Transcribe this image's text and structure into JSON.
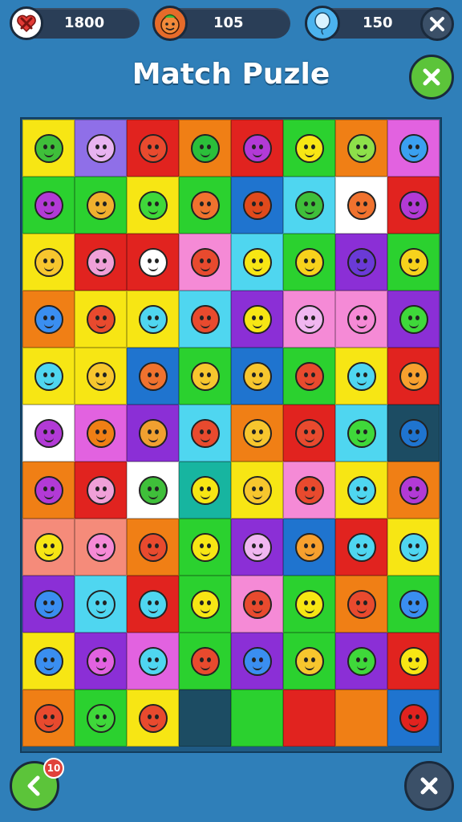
{
  "top_bar": {
    "stat1": {
      "value": "1800",
      "icon": "heart-x-icon",
      "icon_color": "#e23b36"
    },
    "stat2": {
      "value": "105",
      "icon": "character-face-icon",
      "icon_color": "#e66b2a"
    },
    "stat3": {
      "value": "150",
      "icon": "balloon-icon",
      "icon_color": "#4bb3ee"
    },
    "close_icon": "close-icon"
  },
  "title": "Match Puzle",
  "header_close_icon": "close-icon",
  "board": {
    "columns": 8,
    "rows": 11,
    "cells": [
      [
        "#f7e614",
        "#8f6fe8",
        "#e1231f",
        "#f07f15",
        "#e1231f",
        "#2bd12f",
        "#f07f15",
        "#e262e0"
      ],
      [
        "#2bd12f",
        "#2bd12f",
        "#f7e614",
        "#2bd12f",
        "#1f74cf",
        "#4fd6f0",
        "#ffffff",
        "#e1231f"
      ],
      [
        "#f7e614",
        "#e1231f",
        "#e1231f",
        "#f58ad6",
        "#4fd6f0",
        "#2bd12f",
        "#8b2fd6",
        "#2bd12f"
      ],
      [
        "#f07f15",
        "#f7e614",
        "#f7e614",
        "#4fd6f0",
        "#8b2fd6",
        "#f58ad6",
        "#f58ad6",
        "#8b2fd6"
      ],
      [
        "#f7e614",
        "#f7e614",
        "#1f74cf",
        "#2bd12f",
        "#1f74cf",
        "#2bd12f",
        "#f7e614",
        "#e1231f"
      ],
      [
        "#ffffff",
        "#e262e0",
        "#8b2fd6",
        "#4fd6f0",
        "#f07f15",
        "#e1231f",
        "#4fd6f0",
        "#1c4c63"
      ],
      [
        "#f07f15",
        "#e1231f",
        "#ffffff",
        "#17b5a0",
        "#f7e614",
        "#f58ad6",
        "#f7e614",
        "#f07f15"
      ],
      [
        "#f58b7a",
        "#f58b7a",
        "#f07f15",
        "#2bd12f",
        "#8b2fd6",
        "#1f74cf",
        "#e1231f",
        "#f7e614"
      ],
      [
        "#8b2fd6",
        "#4fd6f0",
        "#e1231f",
        "#2bd12f",
        "#f58ad6",
        "#2bd12f",
        "#f07f15",
        "#2bd12f"
      ],
      [
        "#f7e614",
        "#8b2fd6",
        "#e262e0",
        "#2bd12f",
        "#8b2fd6",
        "#2bd12f",
        "#8b2fd6",
        "#e1231f"
      ],
      [
        "#f07f15",
        "#2bd12f",
        "#f7e614",
        "#1c4c63",
        "#2bd12f",
        "#e1231f",
        "#f07f15",
        "#1f74cf"
      ]
    ],
    "faces": [
      [
        "#3fbf3a",
        "#e8b3f0",
        "#e84a2e",
        "#2bbf3a",
        "#b23ad6",
        "#f7e614",
        "#8de04a",
        "#3aa0f0"
      ],
      [
        "#b23ad6",
        "#f0b02e",
        "#3fd83a",
        "#f0722e",
        "#e04a1c",
        "#3fbf3a",
        "#f0722e",
        "#b23ad6"
      ],
      [
        "#f7c62e",
        "#f0a0d8",
        "#ffffff",
        "#e84a2e",
        "#f7e614",
        "#f7d21c",
        "#6a3ad6",
        "#f7d21c"
      ],
      [
        "#3a8ef0",
        "#e84a2e",
        "#4fd6f0",
        "#e84a2e",
        "#f7e614",
        "#f0b6f0",
        "#f58ad6",
        "#3fd83a"
      ],
      [
        "#4fd6f0",
        "#f7c62e",
        "#f0722e",
        "#f7c62e",
        "#f7c62e",
        "#e84a2e",
        "#4fd6f0",
        "#f7a02e"
      ],
      [
        "#b23ad6",
        "#f07f15",
        "#f0a030",
        "#e84a2e",
        "#f7c62e",
        "#e84a2e",
        "#3fd83a",
        "#1f74cf"
      ],
      [
        "#b23ad6",
        "#f0a0d8",
        "#3fbf3a",
        "#f7e614",
        "#f7c62e",
        "#e84a2e",
        "#4fd6f0",
        "#b23ad6"
      ],
      [
        "#f7e614",
        "#f58ad6",
        "#e84a2e",
        "#f7e614",
        "#f0b6f0",
        "#f7a02e",
        "#4fd6f0",
        "#4fd6f0"
      ],
      [
        "#3a8ef0",
        "#4fd6f0",
        "#4fd6f0",
        "#f7e614",
        "#e84a2e",
        "#f7e614",
        "#e84a2e",
        "#3a8ef0"
      ],
      [
        "#3a8ef0",
        "#e262e0",
        "#4fd6f0",
        "#e84a2e",
        "#3a8ef0",
        "#f7c62e",
        "#3fd83a",
        "#f7e614"
      ],
      [
        "#e84a2e",
        "#3fd83a",
        "#e84a2e",
        "",
        "",
        "",
        "",
        "#e1231f"
      ]
    ]
  },
  "bottom": {
    "back_icon": "chevron-left-icon",
    "badge_value": "10",
    "close_icon": "close-icon"
  },
  "colors": {
    "background": "#2f7fb9",
    "pill": "#2a3e57",
    "green_button": "#5cc43a",
    "dark_button": "#3b5068"
  }
}
